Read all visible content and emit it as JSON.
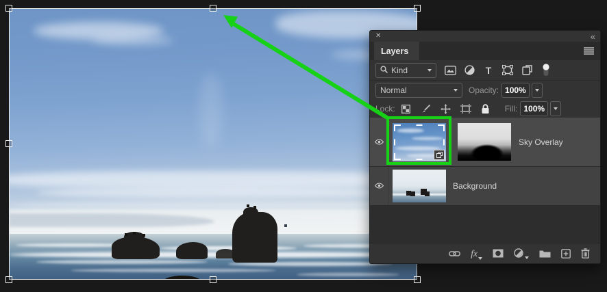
{
  "colors": {
    "accent_green": "#17d117",
    "panel_background": "#333333",
    "selected_row": "#4a4a4a",
    "canvas_background": "#191919"
  },
  "panel": {
    "header": {
      "close_glyph": "✕",
      "collapse_glyph": "«"
    },
    "tab_label": "Layers",
    "filter": {
      "kind_label": "Kind",
      "type_glyph": "T"
    },
    "blend": {
      "mode_value": "Normal",
      "opacity_label": "Opacity:",
      "opacity_value": "100%"
    },
    "lock": {
      "lock_label": "Lock:",
      "fill_label": "Fill:",
      "fill_value": "100%"
    },
    "layers": [
      {
        "name": "Sky Overlay",
        "visible": true,
        "selected": true,
        "has_mask": true,
        "smart_object": true
      },
      {
        "name": "Background",
        "visible": true,
        "selected": false
      }
    ],
    "bottom_bar": {
      "fx_label": "fx"
    }
  }
}
